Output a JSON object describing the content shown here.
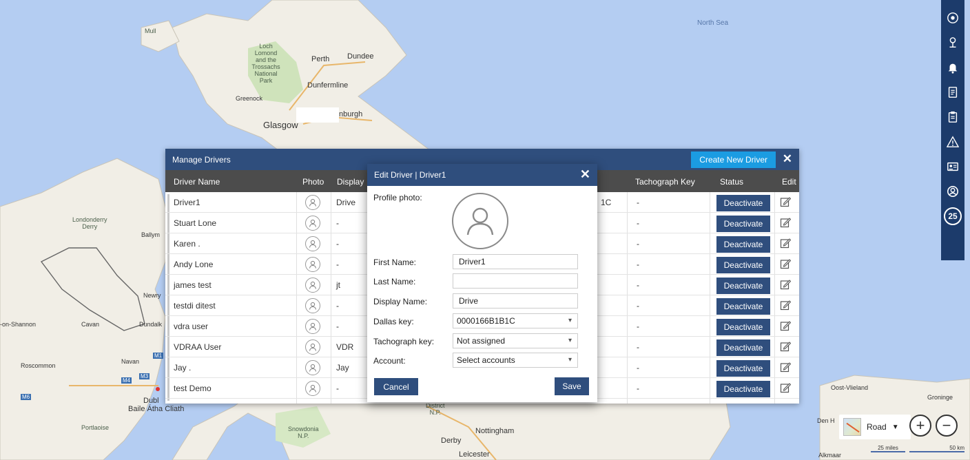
{
  "map": {
    "labels": {
      "north_sea": "North Sea",
      "mull": "Mull",
      "loch_lomond": "Loch\nLomond\nand the\nTrossachs\nNational\nPark",
      "perth": "Perth",
      "dundee": "Dundee",
      "dunfermline": "Dunfermline",
      "greenock": "Greenock",
      "glasgow": "Glasgow",
      "edinburgh": "nburgh",
      "londonderry": "Londonderry\nDerry",
      "ballym": "Ballym",
      "newry": "Newry",
      "on_shannon": "-on-Shannon",
      "cavan": "Cavan",
      "dundalk": "Dundalk",
      "roscommon": "Roscommon",
      "navan": "Navan",
      "dubl": "Dubl",
      "baile": "Baile Átha Cliath",
      "portlaoise": "Portlaoise",
      "snowdonia": "Snowdonia\nN.P.",
      "district": "District\nN.P.",
      "nottingham": "Nottingham",
      "derby": "Derby",
      "leicester": "Leicester",
      "oost_vlieland": "Oost-Vlieland",
      "groninge": "Groninge",
      "den_h": "Den H",
      "alkmaar": "Alkmaar",
      "m1": "M1",
      "m3": "M3",
      "m4": "M4",
      "m6": "M6"
    }
  },
  "map_controls": {
    "layer_label": "Road",
    "zoom_in": "+",
    "zoom_out": "−",
    "scale_miles": "25 miles",
    "scale_km": "50 km"
  },
  "right_toolbar": {
    "badge_count": "25"
  },
  "manage_drivers": {
    "title": "Manage Drivers",
    "create_label": "Create New Driver",
    "close": "✕",
    "columns": {
      "driver_name": "Driver Name",
      "photo": "Photo",
      "display": "Display",
      "tachograph_key": "Tachograph Key",
      "status": "Status",
      "edit": "Edit"
    },
    "rows": [
      {
        "name": "Driver1",
        "display": "Drive",
        "dallas": "1C",
        "tacho": "-",
        "status": "Deactivate"
      },
      {
        "name": "Stuart Lone",
        "display": "-",
        "dallas": "",
        "tacho": "-",
        "status": "Deactivate"
      },
      {
        "name": "Karen .",
        "display": "-",
        "dallas": "",
        "tacho": "-",
        "status": "Deactivate"
      },
      {
        "name": "Andy Lone",
        "display": "-",
        "dallas": "",
        "tacho": "-",
        "status": "Deactivate"
      },
      {
        "name": "james test",
        "display": "jt",
        "dallas": "",
        "tacho": "-",
        "status": "Deactivate"
      },
      {
        "name": "testdi ditest",
        "display": "-",
        "dallas": "",
        "tacho": "-",
        "status": "Deactivate"
      },
      {
        "name": "vdra user",
        "display": "-",
        "dallas": "",
        "tacho": "-",
        "status": "Deactivate"
      },
      {
        "name": "VDRAA User",
        "display": "VDR",
        "dallas": "",
        "tacho": "-",
        "status": "Deactivate"
      },
      {
        "name": "Jay .",
        "display": "Jay",
        "dallas": "",
        "tacho": "-",
        "status": "Deactivate"
      },
      {
        "name": "test Demo",
        "display": "-",
        "dallas": "",
        "tacho": "-",
        "status": "Deactivate"
      }
    ]
  },
  "edit_driver": {
    "title": "Edit Driver | Driver1",
    "close": "✕",
    "profile_photo_label": "Profile photo:",
    "first_name_label": "First Name:",
    "first_name_value": "Driver1",
    "last_name_label": "Last Name:",
    "last_name_value": "",
    "display_name_label": "Display Name:",
    "display_name_value": "Drive",
    "dallas_key_label": "Dallas key:",
    "dallas_key_value": "0000166B1B1C",
    "tachograph_key_label": "Tachograph key:",
    "tachograph_key_value": "Not assigned",
    "account_label": "Account:",
    "account_value": "Select accounts",
    "cancel_label": "Cancel",
    "save_label": "Save"
  },
  "colors": {
    "panel_header": "#2f4e7d",
    "create_button": "#1b9ce2",
    "table_header": "#4c4c4c",
    "toolbar": "#1c3b6b",
    "sea": "#b4cdf2",
    "land": "#f1eee6"
  }
}
